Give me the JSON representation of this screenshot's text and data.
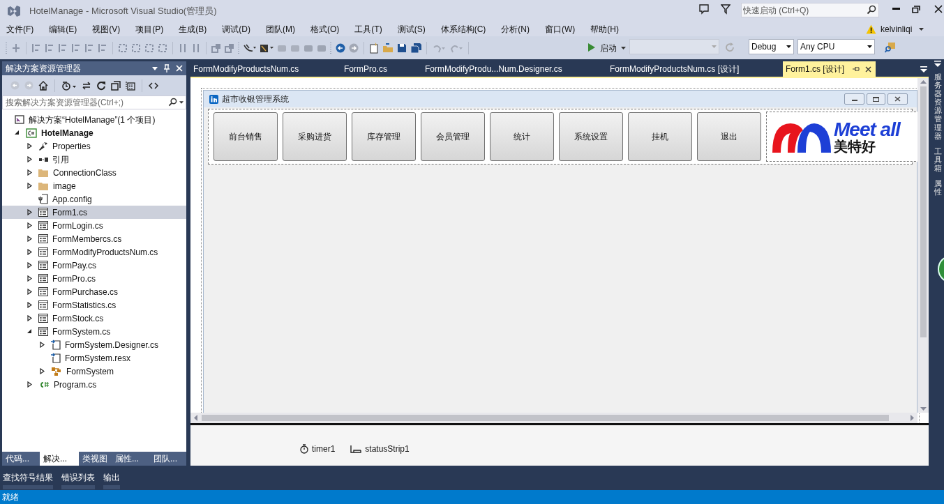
{
  "window": {
    "title": "HotelManage - Microsoft Visual Studio(管理员)"
  },
  "quick_launch": {
    "placeholder": "快速启动 (Ctrl+Q)"
  },
  "menu": [
    "文件(F)",
    "编辑(E)",
    "视图(V)",
    "项目(P)",
    "生成(B)",
    "调试(D)",
    "团队(M)",
    "格式(O)",
    "工具(T)",
    "测试(S)",
    "体系结构(C)",
    "分析(N)",
    "窗口(W)",
    "帮助(H)"
  ],
  "account": {
    "user": "kelvinliqi"
  },
  "toolbar": {
    "start": "启动",
    "configuration": "Debug",
    "platform": "Any CPU"
  },
  "solution_explorer": {
    "title": "解决方案资源管理器",
    "search": {
      "placeholder": "搜索解决方案资源管理器(Ctrl+;)"
    },
    "tree": [
      {
        "label": "解决方案“HotelManage”(1 个项目)",
        "kind": "solution",
        "selected": false,
        "children": [
          {
            "label": "HotelManage",
            "kind": "project",
            "expanded": true,
            "selected": false,
            "children": [
              {
                "label": "Properties",
                "kind": "wrench",
                "expanded": false,
                "selected": false
              },
              {
                "label": "引用",
                "kind": "references",
                "expanded": false,
                "selected": false
              },
              {
                "label": "ConnectionClass",
                "kind": "folder",
                "expanded": false,
                "selected": false
              },
              {
                "label": "image",
                "kind": "folder",
                "expanded": false,
                "selected": false
              },
              {
                "label": "App.config",
                "kind": "config",
                "selected": false
              },
              {
                "label": "Form1.cs",
                "kind": "form",
                "expanded": false,
                "selected": true
              },
              {
                "label": "FormLogin.cs",
                "kind": "form",
                "expanded": false,
                "selected": false
              },
              {
                "label": "FormMembercs.cs",
                "kind": "form",
                "expanded": false,
                "selected": false
              },
              {
                "label": "FormModifyProductsNum.cs",
                "kind": "form",
                "expanded": false,
                "selected": false
              },
              {
                "label": "FormPay.cs",
                "kind": "form",
                "expanded": false,
                "selected": false
              },
              {
                "label": "FormPro.cs",
                "kind": "form",
                "expanded": false,
                "selected": false
              },
              {
                "label": "FormPurchase.cs",
                "kind": "form",
                "expanded": false,
                "selected": false
              },
              {
                "label": "FormStatistics.cs",
                "kind": "form",
                "expanded": false,
                "selected": false
              },
              {
                "label": "FormStock.cs",
                "kind": "form",
                "expanded": false,
                "selected": false
              },
              {
                "label": "FormSystem.cs",
                "kind": "form",
                "expanded": true,
                "selected": false,
                "children": [
                  {
                    "label": "FormSystem.Designer.cs",
                    "kind": "code",
                    "expanded": false,
                    "selected": false
                  },
                  {
                    "label": "FormSystem.resx",
                    "kind": "code",
                    "selected": false
                  },
                  {
                    "label": "FormSystem",
                    "kind": "class",
                    "expanded": false,
                    "selected": false
                  }
                ]
              },
              {
                "label": "Program.cs",
                "kind": "csfile",
                "expanded": false,
                "selected": false
              }
            ]
          }
        ]
      }
    ],
    "bottom_tabs": [
      {
        "label": "代码...",
        "selected": false
      },
      {
        "label": "解决...",
        "selected": true
      },
      {
        "label": "类视图",
        "selected": false
      },
      {
        "label": "属性...",
        "selected": false
      },
      {
        "label": "团队...",
        "selected": false
      }
    ]
  },
  "document_tabs": [
    {
      "label": "FormModifyProductsNum.cs",
      "selected": false
    },
    {
      "label": "FormPro.cs",
      "selected": false
    },
    {
      "label": "FormModifyProdu...Num.Designer.cs",
      "selected": false
    },
    {
      "label": "FormModifyProductsNum.cs [设计]",
      "selected": false
    },
    {
      "label": "Form1.cs [设计]",
      "selected": true
    }
  ],
  "designer": {
    "form_title": "超市收银管理系统",
    "buttons": [
      "前台销售",
      "采购进货",
      "库存管理",
      "会员管理",
      "统计",
      "系统设置",
      "挂机",
      "退出"
    ],
    "logo": {
      "text": "Meet all",
      "subtext": "美特好"
    },
    "components": [
      {
        "kind": "timer",
        "label": "timer1"
      },
      {
        "kind": "status_strip",
        "label": "statusStrip1"
      }
    ]
  },
  "side_tabs": [
    "服务器资源管理器",
    "工具箱",
    "属性"
  ],
  "output_tabs": [
    "查找符号结果",
    "错误列表",
    "输出"
  ],
  "status_bar": {
    "text": "就绪"
  }
}
